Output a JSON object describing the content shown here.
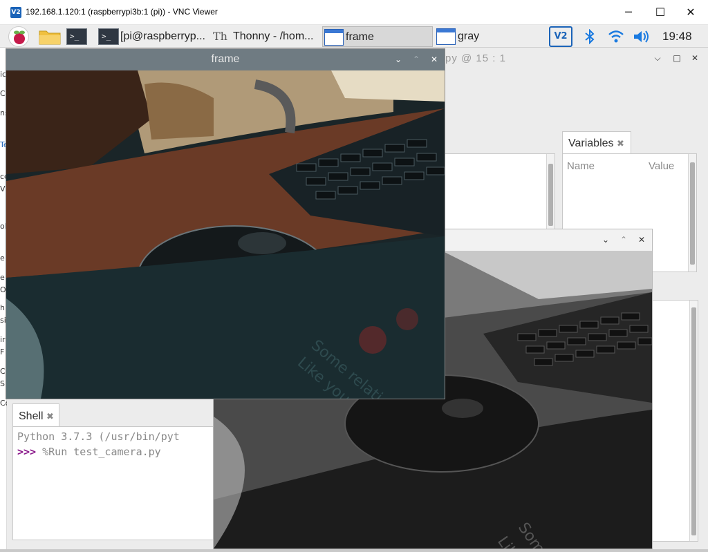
{
  "vnc": {
    "logo": "V2",
    "title": "192.168.1.120:1 (raspberrypi3b:1 (pi)) - VNC Viewer",
    "minimize": "─",
    "maximize": "☐",
    "close": "✕"
  },
  "taskbar": {
    "terminal1_glyph": ">_",
    "terminal2_label": "[pi@raspberryp...",
    "thonny_label": "Thonny  -  /hom...",
    "frame_label": "frame",
    "gray_label": "gray",
    "vnc_icon": "V2",
    "clock": "19:48"
  },
  "thonny": {
    "title_fragment": "py  @  15 : 1",
    "variables_tab": "Variables",
    "variables_cols": [
      "Name",
      "Value"
    ],
    "shell_tab": "Shell",
    "shell_line1": "Python 3.7.3 (/usr/bin/pyt",
    "shell_prompt": ">>>",
    "shell_command": " %Run test_camera.py",
    "left_fragments": [
      "ic",
      "C",
      "ns",
      "Te",
      "co",
      "VI",
      "ob",
      "e",
      "e",
      "O",
      "h",
      "si",
      "ir",
      "F",
      "C",
      "S",
      "Co"
    ]
  },
  "frame_window": {
    "title": "frame",
    "image_text": [
      "Some relati",
      "Like your"
    ]
  },
  "gray_window": {
    "title": "",
    "image_text": [
      "Some",
      "Like"
    ]
  }
}
